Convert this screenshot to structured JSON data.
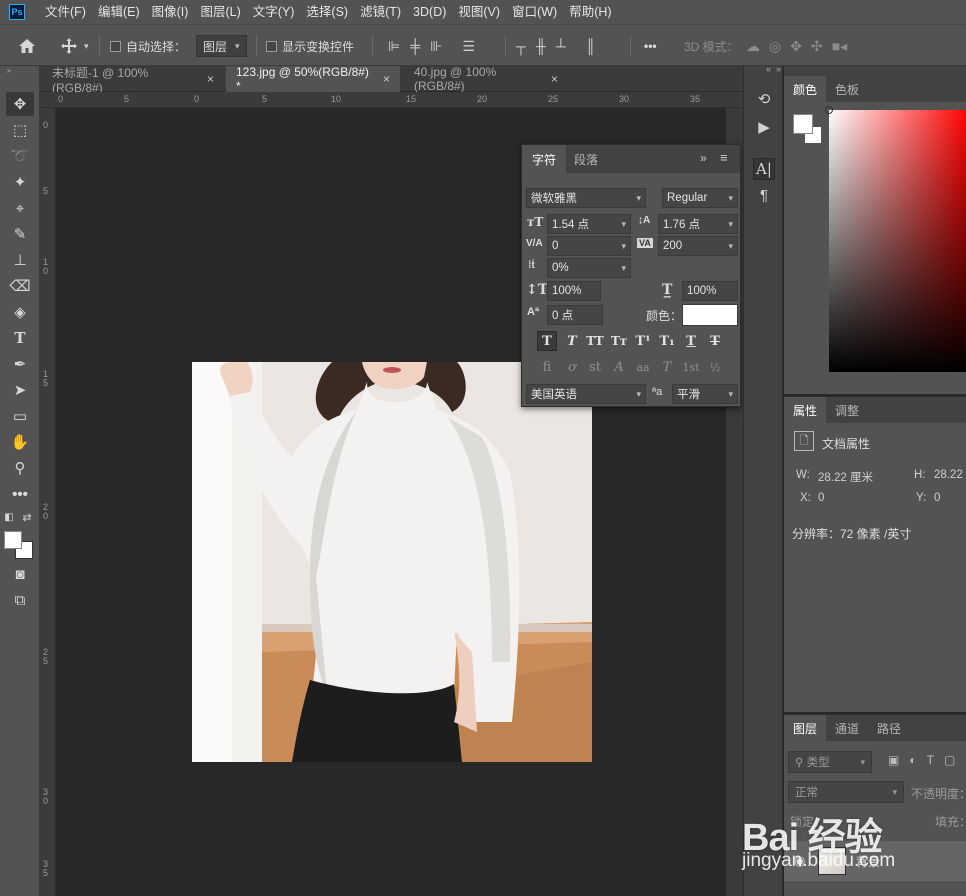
{
  "app": {
    "logo": "Ps"
  },
  "menu": [
    "文件(F)",
    "编辑(E)",
    "图像(I)",
    "图层(L)",
    "文字(Y)",
    "选择(S)",
    "滤镜(T)",
    "3D(D)",
    "视图(V)",
    "窗口(W)",
    "帮助(H)"
  ],
  "options": {
    "auto_select_label": "自动选择：",
    "auto_select_value": "图层",
    "show_transform_label": "显示变换控件",
    "mode_3d_label": "3D 模式：",
    "more": "•••"
  },
  "tabs": [
    {
      "label": "未标题-1 @ 100%(RGB/8#)",
      "close": "×"
    },
    {
      "label": "123.jpg @ 50%(RGB/8#) *",
      "close": "×"
    },
    {
      "label": "40.jpg @ 100%(RGB/8#)",
      "close": "×"
    }
  ],
  "ruler_top": [
    "0",
    "5",
    "0",
    "5",
    "10",
    "15",
    "20",
    "25",
    "30",
    "35"
  ],
  "ruler_left": [
    "0",
    "5",
    "1 0",
    "1 5",
    "2 0",
    "2 5",
    "3 0",
    "3 5"
  ],
  "character": {
    "tabs": [
      "字符",
      "段落"
    ],
    "font_family": "微软雅黑",
    "font_style": "Regular",
    "font_size": "1.54 点",
    "leading": "1.76 点",
    "kerning": "0",
    "tracking": "200",
    "tsume": "0%",
    "vertical_scale": "100%",
    "horizontal_scale": "100%",
    "baseline_shift": "0 点",
    "color_label": "颜色：",
    "color_value": "#ffffff",
    "language": "美国英语",
    "antialias_icon": "ªa",
    "antialias": "平滑",
    "style_buttons": [
      "T",
      "T",
      "TT",
      "Tт",
      "T¹",
      "T₁",
      "T",
      "T"
    ],
    "opentype_buttons": [
      "ﬁ",
      "ơ",
      "st",
      "A",
      "aa",
      "T",
      "1st",
      "½"
    ]
  },
  "color_panel": {
    "tabs": [
      "颜色",
      "色板"
    ]
  },
  "properties": {
    "tabs": [
      "属性",
      "调整"
    ],
    "title": "文档属性",
    "w_label": "W:",
    "w_value": "28.22 厘米",
    "h_label": "H:",
    "h_value": "28.22",
    "x_label": "X:",
    "x_value": "0",
    "y_label": "Y:",
    "y_value": "0",
    "resolution": "分辨率：72 像素 /英寸"
  },
  "layers": {
    "tabs": [
      "图层",
      "通道",
      "路径"
    ],
    "kind_filter": "类型",
    "blend_mode": "正常",
    "opacity_label": "不透明度：",
    "lock_label": "锁定：",
    "fill_label": "填充：",
    "layer_name": "背景"
  },
  "watermark": {
    "brand": "Bai 经验",
    "url": "jingyan.baidu.com"
  }
}
